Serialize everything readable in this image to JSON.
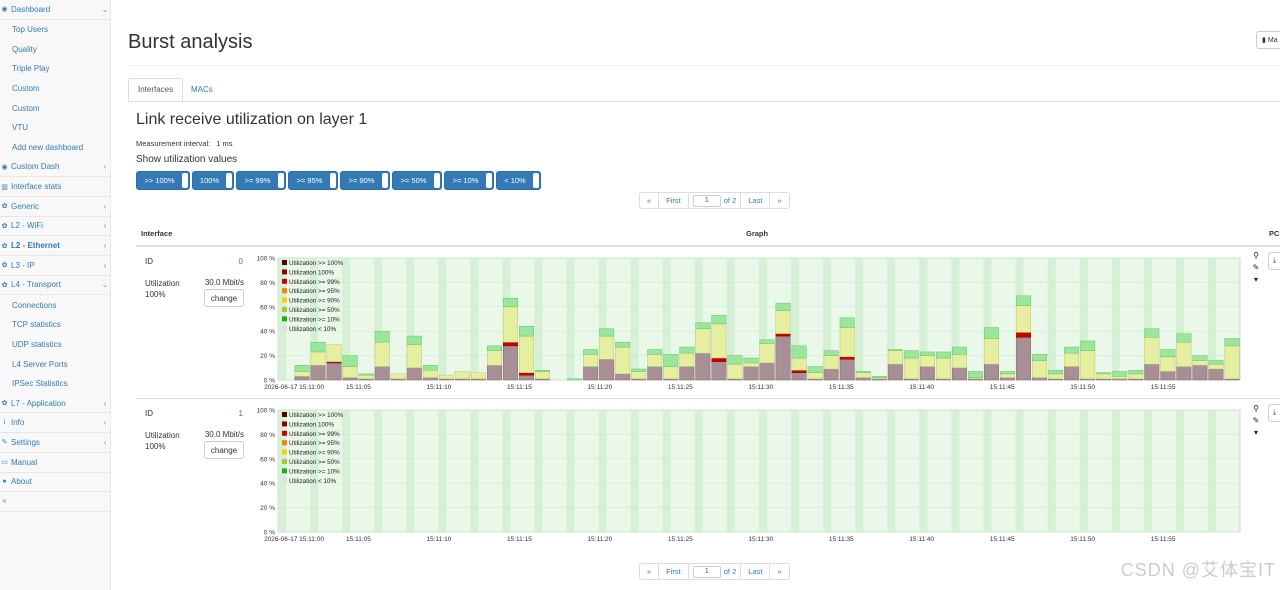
{
  "sidebar": {
    "items": [
      {
        "icon": "dashboard-icon",
        "glyph": "◉",
        "label": "Dashboard",
        "chev": "⌄",
        "type": "top"
      },
      {
        "label": "Top Users",
        "type": "sub"
      },
      {
        "label": "Quality",
        "type": "sub"
      },
      {
        "label": "Triple Play",
        "type": "sub"
      },
      {
        "label": "Custom",
        "type": "sub"
      },
      {
        "label": "Custom",
        "type": "sub"
      },
      {
        "label": "VTU",
        "type": "sub"
      },
      {
        "label": "Add new dashboard",
        "type": "sub"
      },
      {
        "icon": "dashboard-icon",
        "glyph": "◉",
        "label": "Custom Dash",
        "chev": "‹",
        "type": "top"
      },
      {
        "icon": "bar-chart-icon",
        "glyph": "▥",
        "label": "Interface stats",
        "chev": "",
        "type": "top"
      },
      {
        "icon": "gear-icon",
        "glyph": "✿",
        "label": "Generic",
        "chev": "‹",
        "type": "top"
      },
      {
        "icon": "gear-icon",
        "glyph": "✿",
        "label": "L2 - WiFi",
        "chev": "‹",
        "type": "top"
      },
      {
        "icon": "gear-icon",
        "glyph": "✿",
        "label": "L2 - Ethernet",
        "chev": "‹",
        "type": "top",
        "bold": true
      },
      {
        "icon": "gear-icon",
        "glyph": "✿",
        "label": "L3 - IP",
        "chev": "‹",
        "type": "top"
      },
      {
        "icon": "gear-icon",
        "glyph": "✿",
        "label": "L4 - Transport",
        "chev": "⌄",
        "type": "top"
      },
      {
        "label": "Connections",
        "type": "sub"
      },
      {
        "label": "TCP statistics",
        "type": "sub"
      },
      {
        "label": "UDP statistics",
        "type": "sub"
      },
      {
        "label": "L4 Server Ports",
        "type": "sub"
      },
      {
        "label": "IPSec Statistics",
        "type": "sub"
      },
      {
        "icon": "gear-icon",
        "glyph": "✿",
        "label": "L7 - Application",
        "chev": "‹",
        "type": "top"
      },
      {
        "icon": "info-icon",
        "glyph": "i",
        "label": "Info",
        "chev": "‹",
        "type": "top"
      },
      {
        "icon": "wrench-icon",
        "glyph": "✎",
        "label": "Settings",
        "chev": "‹",
        "type": "top"
      },
      {
        "icon": "book-icon",
        "glyph": "▭",
        "label": "Manual",
        "chev": "",
        "type": "top"
      },
      {
        "icon": "info-circle-icon",
        "glyph": "●",
        "label": "About",
        "chev": "",
        "type": "top"
      },
      {
        "icon": "collapse-icon",
        "glyph": "«",
        "label": "",
        "chev": "",
        "type": "top"
      }
    ]
  },
  "page": {
    "title": "Burst analysis",
    "manual_label": "Ma"
  },
  "tabs": [
    {
      "label": "Interfaces",
      "active": true
    },
    {
      "label": "MACs",
      "active": false
    }
  ],
  "section": {
    "title": "Link receive utilization on layer 1",
    "meas_label": "Measurement interval:",
    "meas_value": "1 ms",
    "show_label": "Show utilization values"
  },
  "filters": [
    ">> 100%",
    "100%",
    ">= 99%",
    ">= 95%",
    ">= 90%",
    ">= 50%",
    ">= 10%",
    "< 10%"
  ],
  "pager": {
    "prev": "«",
    "first": "First",
    "page": "1",
    "of": "of 2",
    "last": "Last",
    "next": "»"
  },
  "table": {
    "col_interface": "Interface",
    "col_graph": "Graph",
    "col_extra": "PC"
  },
  "rows": [
    {
      "id_label": "ID",
      "id_value": "0",
      "util_label": "Utilization",
      "util_value": "100%",
      "bandwidth": "30.0 Mbit/s",
      "change_label": "change"
    },
    {
      "id_label": "ID",
      "id_value": "1",
      "util_label": "Utilization",
      "util_value": "100%",
      "bandwidth": "30.0 Mbit/s",
      "change_label": "change"
    }
  ],
  "watermark": "CSDN @艾体宝IT",
  "chart_data": [
    {
      "type": "bar",
      "stacked": true,
      "title": "",
      "ylabel": "",
      "ylim": [
        0,
        100
      ],
      "yticks": [
        "0 %",
        "20 %",
        "40 %",
        "60 %",
        "80 %",
        "100 %"
      ],
      "xticks": [
        "2026-06-17 15:11:00",
        "15:11:05",
        "15:11:10",
        "15:11:15",
        "15:11:20",
        "15:11:25",
        "15:11:30",
        "15:11:35",
        "15:11:40",
        "15:11:45",
        "15:11:50",
        "15:11:55"
      ],
      "legend": [
        "Utilization >> 100%",
        "Utilization 100%",
        "Utilization >= 99%",
        "Utilization >= 95%",
        "Utilization >= 90%",
        "Utilization >= 50%",
        "Utilization >= 10%",
        "Utilization < 10%"
      ],
      "legend_position": "top-left",
      "colors": {
        "u_gt100": "#550000",
        "u_100": "#8b0000",
        "u_99": "#cc0000",
        "u_95": "#ff7f00",
        "u_90": "#ffcc00",
        "u_50": "#a8c83c",
        "u_10": "#22aa22",
        "u_lt10": "#dddddd"
      },
      "bar_colors": {
        "base": "#a88f96",
        "base_stroke": "#7f6870",
        "mid": "#e6ef9f",
        "top": "#9ae69a"
      },
      "background": {
        "plot": "#e9f8e9",
        "band": "#d6f0d6"
      },
      "num_bars": 60,
      "series": [
        {
          "name": "base",
          "values": [
            0,
            3,
            12,
            14,
            2,
            1,
            11,
            1,
            10,
            2,
            1,
            1,
            1,
            12,
            28,
            4,
            1,
            0,
            0,
            11,
            17,
            5,
            1,
            11,
            1,
            11,
            22,
            15,
            1,
            11,
            14,
            36,
            6,
            1,
            9,
            17,
            2,
            1,
            13,
            1,
            11,
            1,
            10,
            1,
            13,
            2,
            35,
            2,
            1,
            11,
            1,
            1,
            1,
            1,
            13,
            7,
            11,
            12,
            9,
            1
          ]
        },
        {
          "name": "red",
          "values": [
            0,
            0,
            0,
            1,
            0,
            0,
            0,
            0,
            0,
            0,
            0,
            0,
            0,
            0,
            3,
            2,
            0,
            0,
            0,
            0,
            0,
            0,
            0,
            0,
            0,
            0,
            0,
            3,
            0,
            0,
            0,
            2,
            2,
            0,
            0,
            2,
            0,
            0,
            0,
            0,
            0,
            0,
            0,
            0,
            0,
            0,
            4,
            0,
            0,
            0,
            0,
            0,
            0,
            0,
            0,
            0,
            0,
            0,
            0,
            0
          ]
        },
        {
          "name": "mid",
          "values": [
            0,
            4,
            11,
            14,
            9,
            3,
            20,
            4,
            19,
            6,
            3,
            6,
            5,
            12,
            29,
            30,
            6,
            0,
            0,
            10,
            19,
            22,
            6,
            10,
            10,
            11,
            20,
            28,
            12,
            3,
            16,
            19,
            10,
            5,
            11,
            24,
            4,
            1,
            11,
            17,
            9,
            17,
            11,
            1,
            21,
            3,
            22,
            14,
            4,
            11,
            23,
            4,
            2,
            4,
            22,
            12,
            20,
            4,
            4,
            27
          ]
        },
        {
          "name": "top",
          "values": [
            0,
            5,
            8,
            0,
            9,
            1,
            9,
            0,
            7,
            4,
            0,
            0,
            0,
            4,
            7,
            8,
            1,
            0,
            1,
            4,
            6,
            4,
            2,
            4,
            10,
            5,
            5,
            7,
            7,
            4,
            3,
            6,
            10,
            5,
            4,
            8,
            1,
            1,
            1,
            6,
            3,
            5,
            6,
            5,
            9,
            2,
            8,
            5,
            3,
            5,
            8,
            1,
            4,
            3,
            7,
            6,
            7,
            4,
            3,
            6
          ]
        }
      ]
    },
    {
      "type": "bar",
      "stacked": true,
      "title": "",
      "ylabel": "",
      "ylim": [
        0,
        100
      ],
      "yticks": [
        "0 %",
        "20 %",
        "40 %",
        "60 %",
        "80 %",
        "100 %"
      ],
      "xticks": [
        "2026-06-17 15:11:00",
        "15:11:05",
        "15:11:10",
        "15:11:15",
        "15:11:20",
        "15:11:25",
        "15:11:30",
        "15:11:35",
        "15:11:40",
        "15:11:45",
        "15:11:50",
        "15:11:55"
      ],
      "legend": [
        "Utilization >> 100%",
        "Utilization 100%",
        "Utilization >= 99%",
        "Utilization >= 95%",
        "Utilization >= 90%",
        "Utilization >= 50%",
        "Utilization >= 10%",
        "Utilization < 10%"
      ],
      "legend_position": "top-left",
      "colors": {
        "u_gt100": "#550000",
        "u_100": "#8b0000",
        "u_99": "#cc0000",
        "u_95": "#ff7f00",
        "u_90": "#ffcc00",
        "u_50": "#a8c83c",
        "u_10": "#22aa22",
        "u_lt10": "#dddddd"
      },
      "background": {
        "plot": "#e9f8e9",
        "band": "#d6f0d6"
      },
      "num_bars": 60,
      "series": []
    }
  ]
}
